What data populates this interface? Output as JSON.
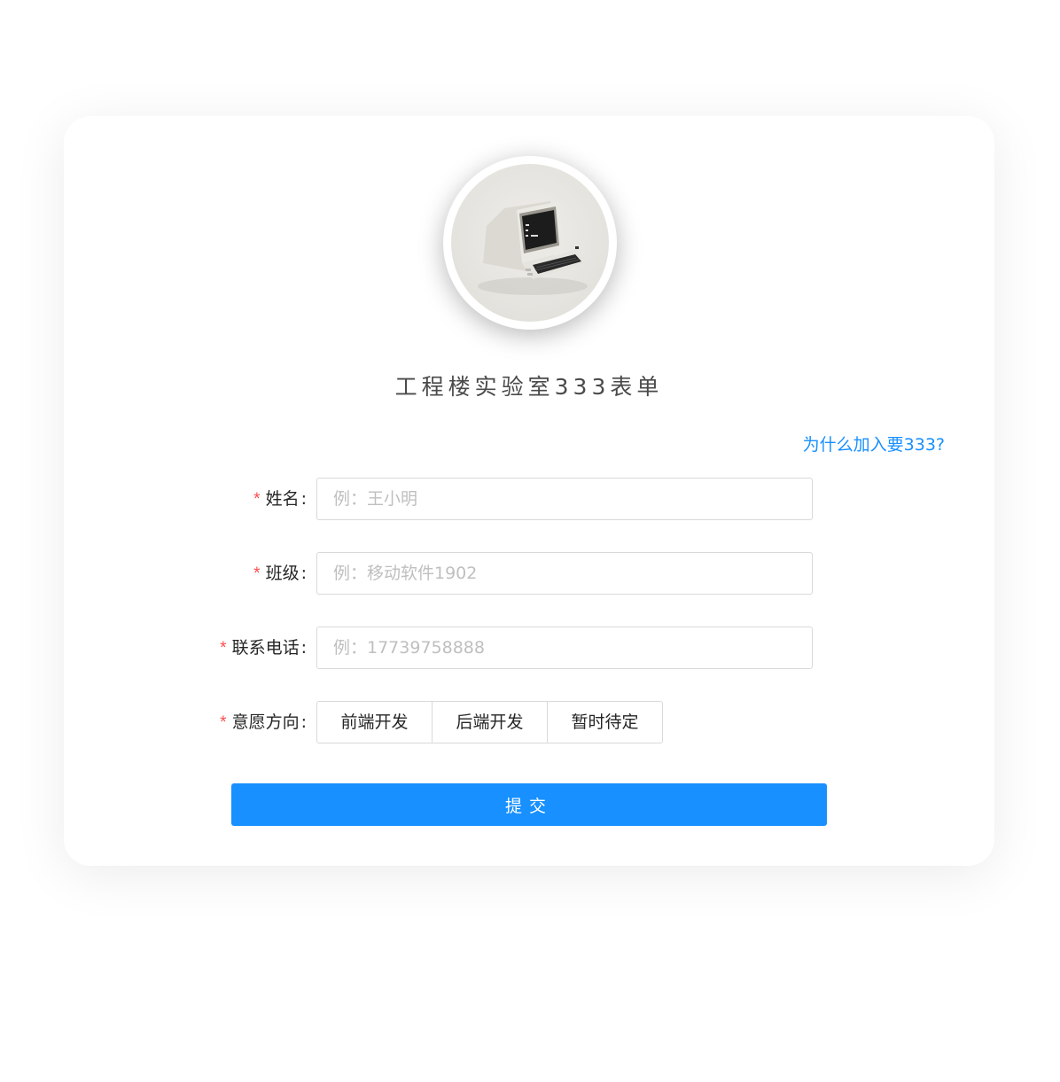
{
  "form": {
    "title": "工程楼实验室333表单",
    "why_link": "为什么加入要333?",
    "required_mark": "*",
    "colon": ":",
    "fields": [
      {
        "label": "姓名",
        "placeholder": "例：王小明"
      },
      {
        "label": "班级",
        "placeholder": "例：移动软件1902"
      },
      {
        "label": "联系电话",
        "placeholder": "例：17739758888"
      }
    ],
    "direction": {
      "label": "意愿方向",
      "options": [
        "前端开发",
        "后端开发",
        "暂时待定"
      ]
    },
    "submit_label": "提交"
  },
  "colors": {
    "accent": "#1890ff",
    "required": "#ff4d4f"
  },
  "icons": {
    "avatar": "retro-computer-terminal-icon"
  }
}
